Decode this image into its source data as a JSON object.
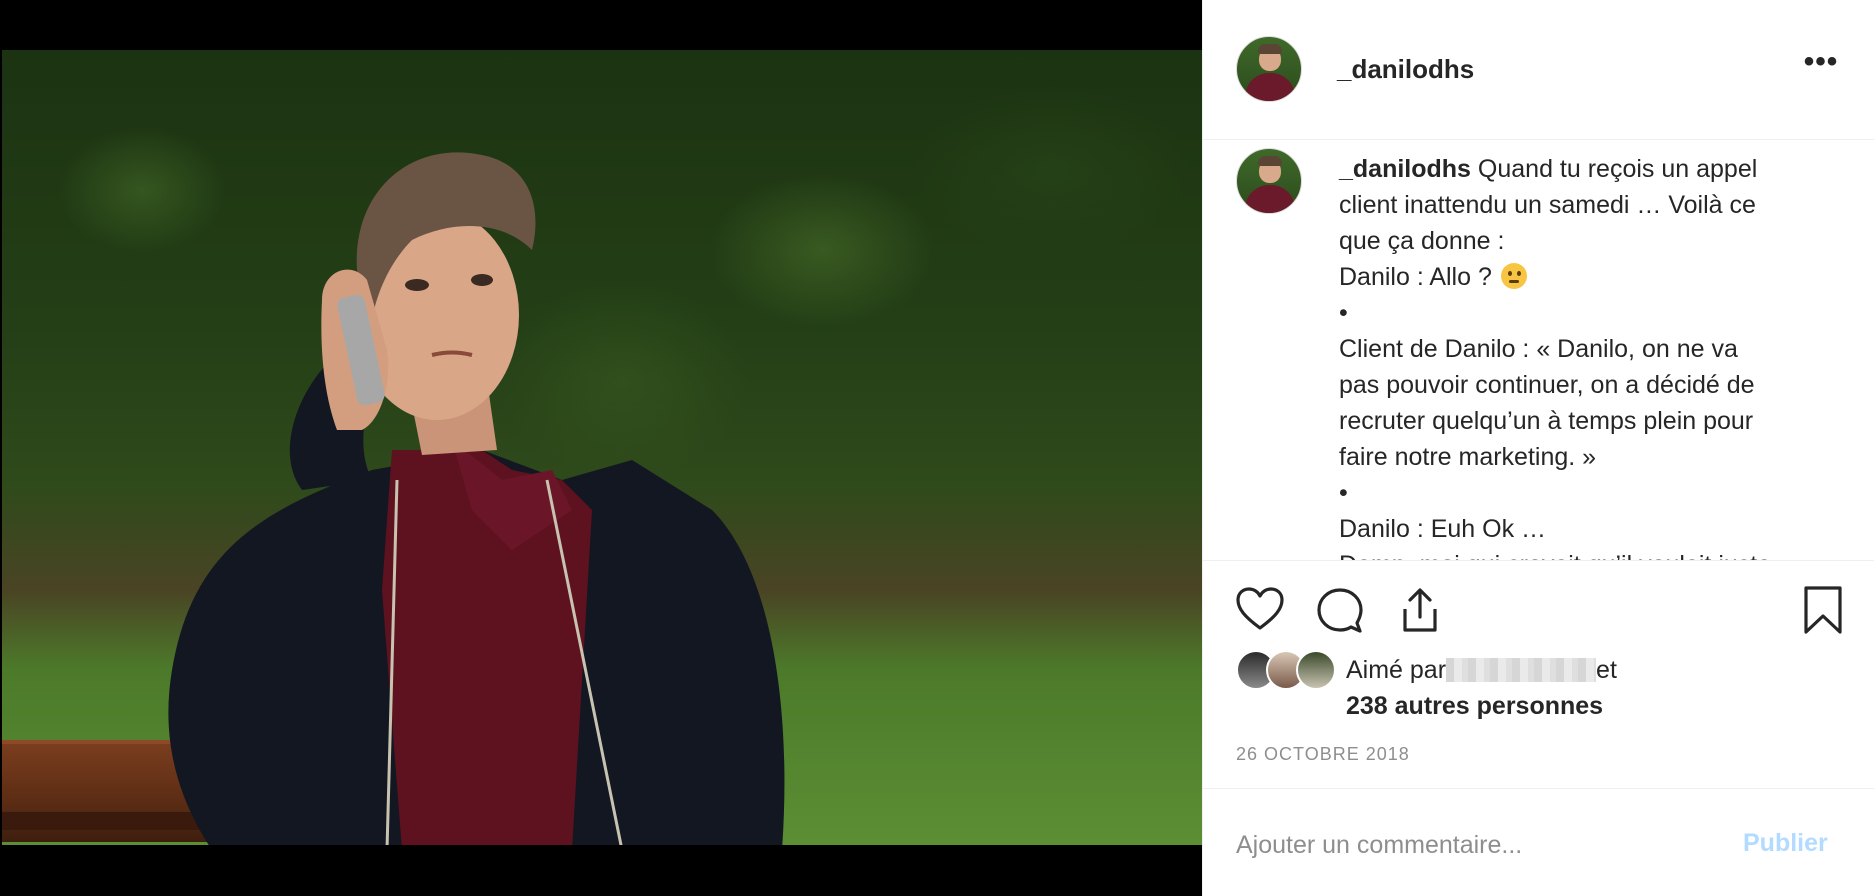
{
  "post": {
    "username": "_danilodhs",
    "caption": {
      "username": "_danilodhs",
      "lines": [
        "Quand tu reçois un appel",
        "client inattendu un samedi … Voilà ce",
        "que ça donne :",
        "Danilo : Allo ?",
        "•",
        "Client de Danilo : « Danilo, on ne va",
        "pas pouvoir continuer, on a décidé de",
        "recruter quelqu’un à temps plein pour",
        "faire notre marketing. »",
        "•",
        "Danilo : Euh Ok …",
        "Damn, moi qui croyait qu’il voulait juste"
      ]
    },
    "likes": {
      "prefix": "Aimé par",
      "suffix": "et",
      "count_text": "238 autres personnes"
    },
    "date": "26 OCTOBRE 2018",
    "comment": {
      "placeholder": "Ajouter un commentaire...",
      "publish_label": "Publier"
    }
  },
  "icons": {
    "more": "more-options-icon",
    "like": "heart-icon",
    "comment": "comment-bubble-icon",
    "share": "share-icon",
    "save": "bookmark-icon",
    "emoji": "thinking-face-emoji"
  },
  "colors": {
    "text": "#262626",
    "muted": "#8e8e8e",
    "publish_disabled": "#b3dbff",
    "border": "#efefef"
  }
}
